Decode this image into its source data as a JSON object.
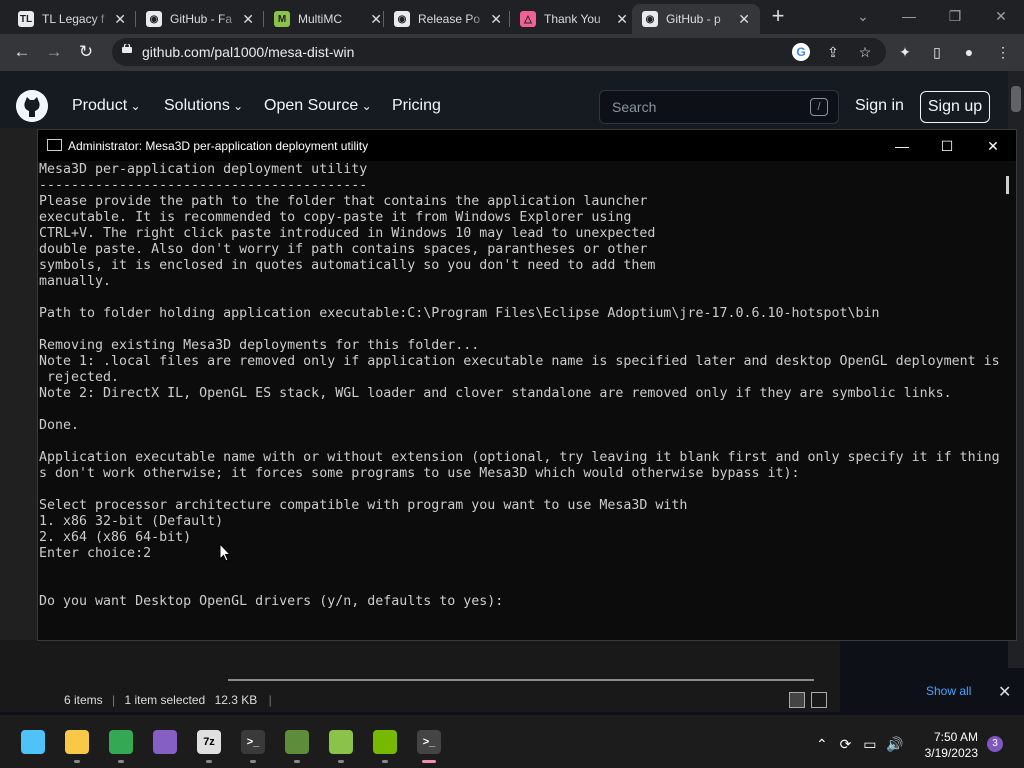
{
  "browser": {
    "tabs": [
      {
        "title": "TL Legacy f",
        "favicon": "tl-legacy-icon",
        "color": "#e8eaed"
      },
      {
        "title": "GitHub - Fa",
        "favicon": "github-icon",
        "color": "#e8eaed"
      },
      {
        "title": "MultiMC",
        "favicon": "multimc-icon",
        "color": "#8bc34a"
      },
      {
        "title": "Release Po",
        "favicon": "github-icon",
        "color": "#e8eaed"
      },
      {
        "title": "Thank You",
        "favicon": "thank-you-icon",
        "color": "#f06292"
      },
      {
        "title": "GitHub - p",
        "favicon": "github-icon",
        "color": "#e8eaed"
      }
    ],
    "new_tab": "+",
    "url": "github.com/pal1000/mesa-dist-win"
  },
  "github": {
    "nav": [
      "Product",
      "Solutions",
      "Open Source",
      "Pricing"
    ],
    "search_placeholder": "Search",
    "search_shortcut": "/",
    "sign_in": "Sign in",
    "sign_up": "Sign up"
  },
  "console": {
    "title": "Administrator:  Mesa3D per-application deployment utility",
    "lines": [
      "Mesa3D per-application deployment utility",
      "-----------------------------------------",
      "Please provide the path to the folder that contains the application launcher",
      "executable. It is recommended to copy-paste it from Windows Explorer using",
      "CTRL+V. The right click paste introduced in Windows 10 may lead to unexpected",
      "double paste. Also don't worry if path contains spaces, parantheses or other",
      "symbols, it is enclosed in quotes automatically so you don't need to add them",
      "manually.",
      "",
      "Path to folder holding application executable:C:\\Program Files\\Eclipse Adoptium\\jre-17.0.6.10-hotspot\\bin",
      "",
      "Removing existing Mesa3D deployments for this folder...",
      "Note 1: .local files are removed only if application executable name is specified later and desktop OpenGL deployment is",
      " rejected.",
      "Note 2: DirectX IL, OpenGL ES stack, WGL loader and clover standalone are removed only if they are symbolic links.",
      "",
      "Done.",
      "",
      "Application executable name with or without extension (optional, try leaving it blank first and only specify it if thing",
      "s don't work otherwise; it forces some programs to use Mesa3D which would otherwise bypass it):",
      "",
      "Select processor architecture compatible with program you want to use Mesa3D with",
      "1. x86 32-bit (Default)",
      "2. x64 (x86 64-bit)",
      "Enter choice:2",
      "",
      "",
      "Do you want Desktop OpenGL drivers (y/n, defaults to yes):"
    ]
  },
  "explorer": {
    "items": "6 items",
    "selected": "1 item selected",
    "size": "12.3 KB",
    "show_all": "Show all"
  },
  "taskbar": {
    "icons": [
      {
        "name": "start-icon",
        "color": "#4fc3f7"
      },
      {
        "name": "file-explorer-icon",
        "color": "#f9c846"
      },
      {
        "name": "chrome-icon",
        "color": "#34a853"
      },
      {
        "name": "visual-studio-icon",
        "color": "#865fc5"
      },
      {
        "name": "7zip-icon",
        "color": "#e0e0e0"
      },
      {
        "name": "terminal-icon",
        "color": "#3a3a3a"
      },
      {
        "name": "minecraft-icon",
        "color": "#5d8c3b"
      },
      {
        "name": "multimc-icon",
        "color": "#8bc34a"
      },
      {
        "name": "nvidia-icon",
        "color": "#76b900"
      },
      {
        "name": "cmd-icon",
        "color": "#444444"
      }
    ],
    "time": "7:50 AM",
    "date": "3/19/2023",
    "notifications": "3"
  }
}
